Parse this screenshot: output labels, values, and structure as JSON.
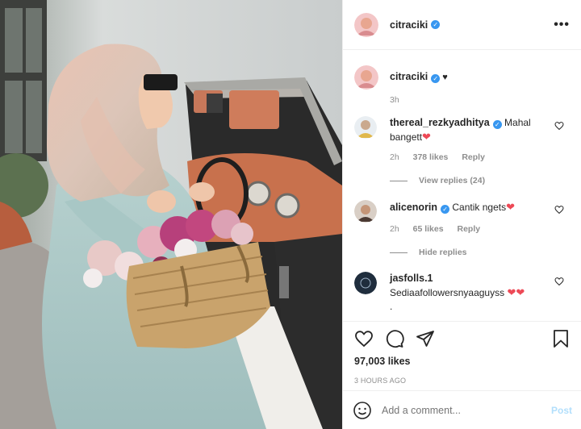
{
  "header": {
    "username": "citraciki",
    "more_label": "•••"
  },
  "caption": {
    "username": "citraciki",
    "time": "3h"
  },
  "comments": [
    {
      "username": "thereal_rezkyadhitya",
      "verified": true,
      "text": "Mahal bangett",
      "time": "2h",
      "likes": "378 likes",
      "reply_label": "Reply",
      "replies_label": "View replies (24)"
    },
    {
      "username": "alicenorin",
      "verified": true,
      "text": "Cantik ngets",
      "time": "2h",
      "likes": "65 likes",
      "reply_label": "Reply",
      "replies_label": "Hide replies"
    },
    {
      "username": "jasfolls.1",
      "verified": false,
      "text": "Sediaafollowersnyaaguyss",
      "trailing": "."
    }
  ],
  "footer": {
    "likes": "97,003 likes",
    "time_ago": "3 HOURS AGO",
    "comment_placeholder": "Add a comment...",
    "post_label": "Post"
  },
  "icons": {
    "like": "heart-icon",
    "comment": "speech-bubble-icon",
    "share": "paper-plane-icon",
    "save": "bookmark-icon",
    "emoji": "smiley-icon",
    "verified": "verified-badge-icon"
  },
  "colors": {
    "verified": "#3897f0",
    "heart": "#ed4956",
    "post_disabled": "#b2dffc",
    "muted": "#8e8e8e"
  }
}
